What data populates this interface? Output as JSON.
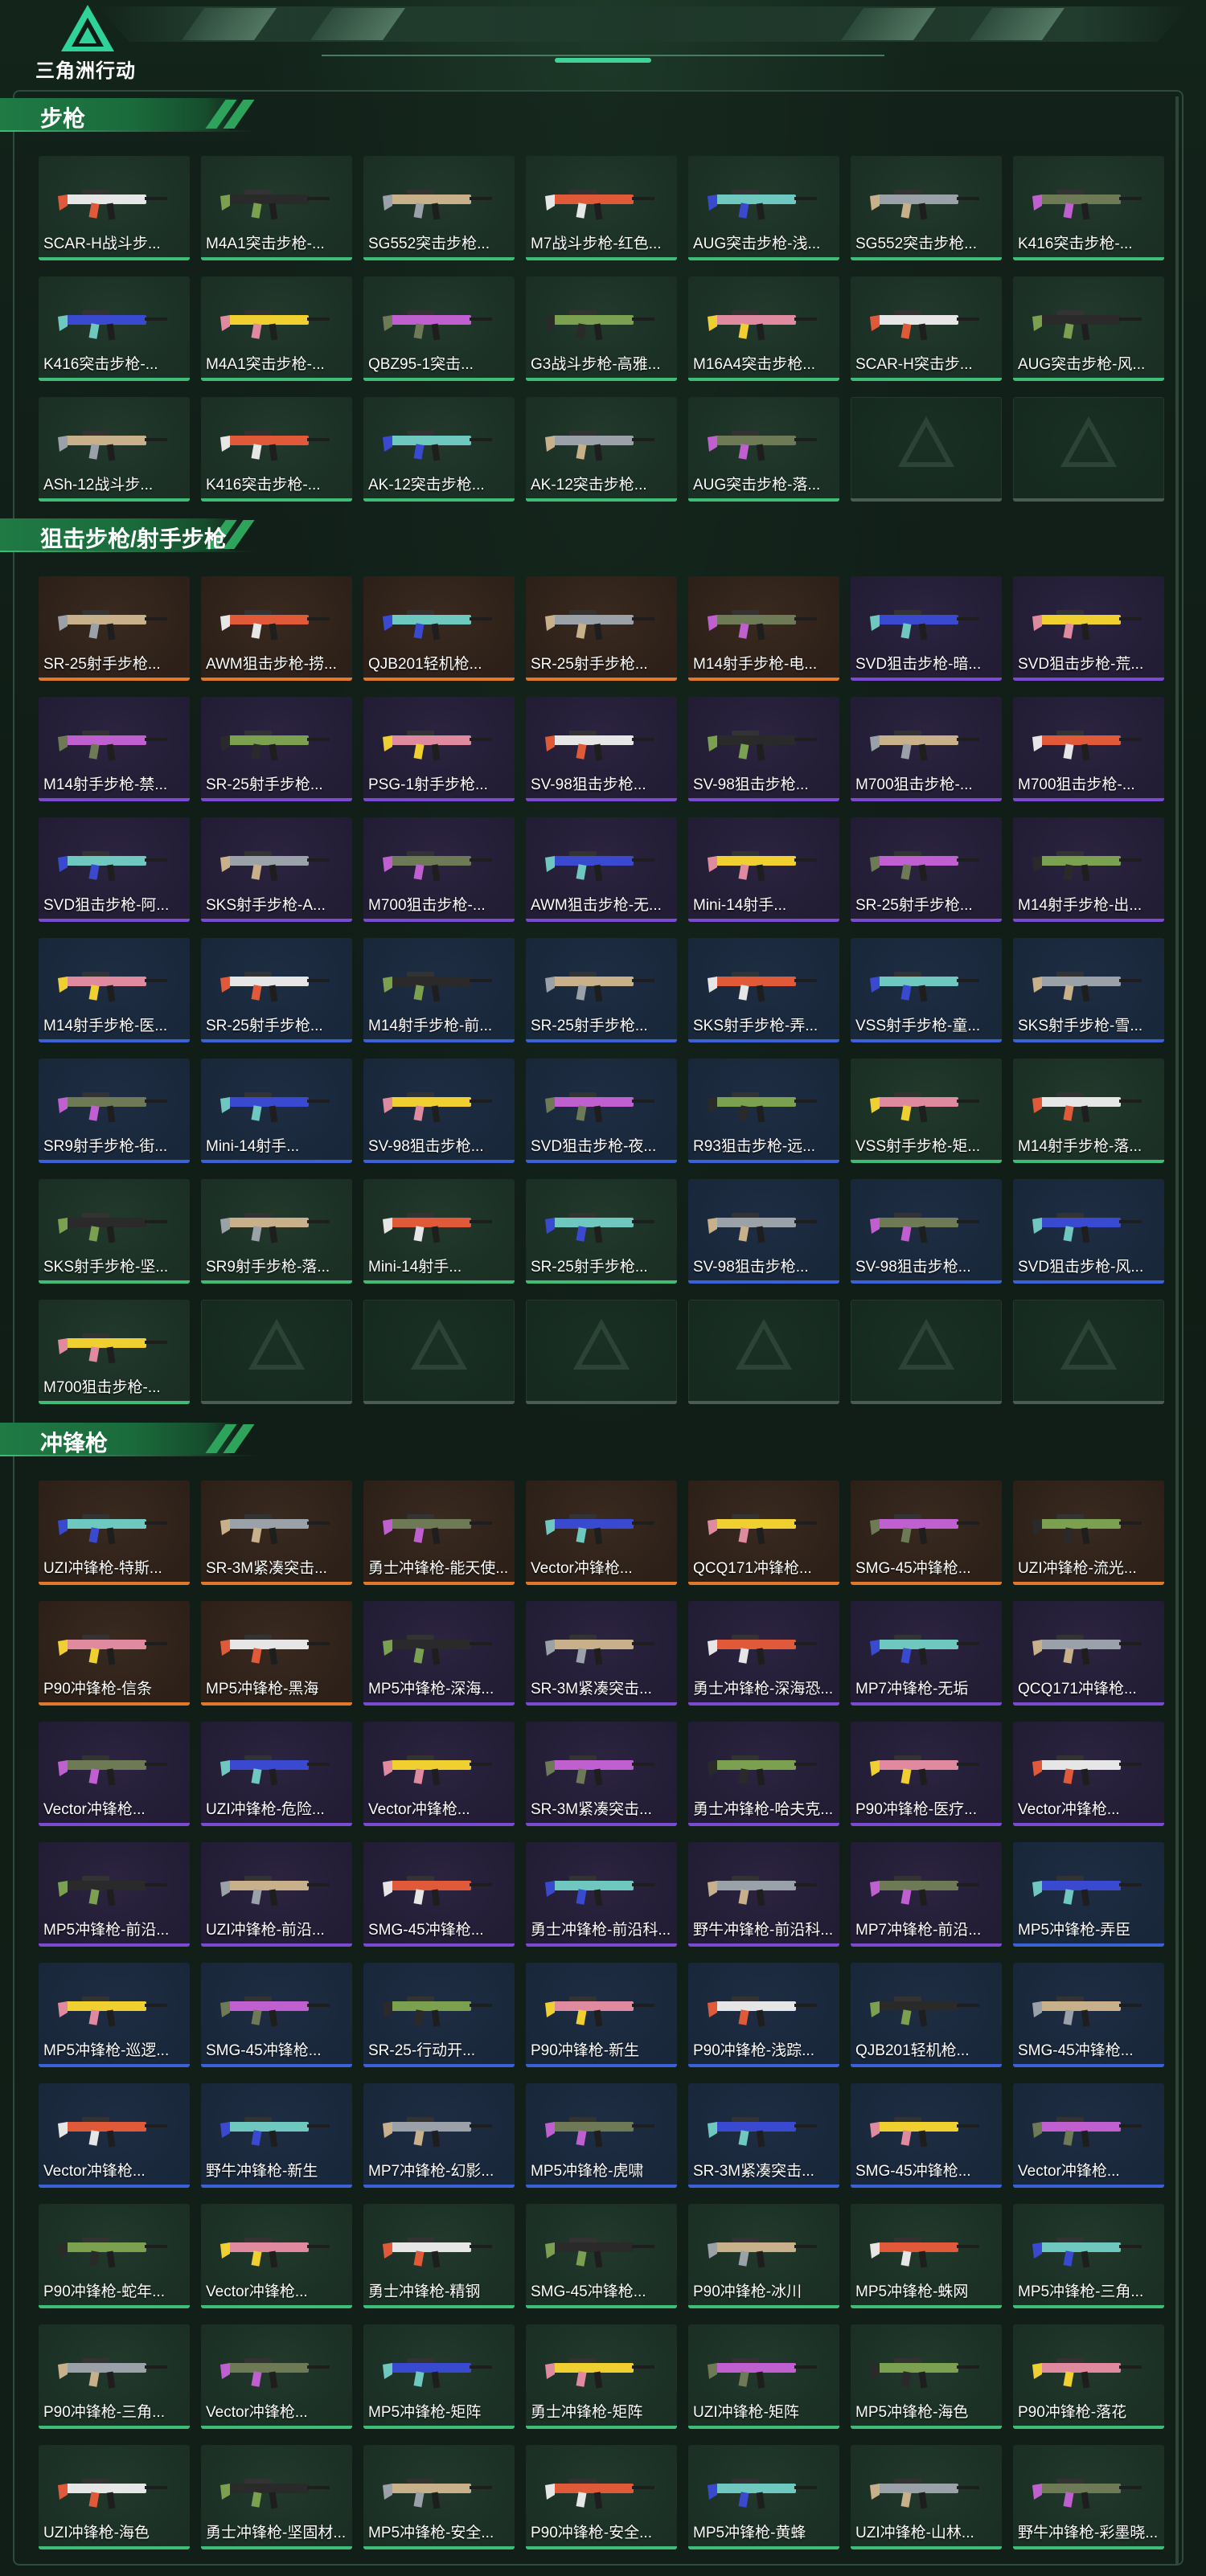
{
  "header": {
    "logo_text": "三角洲行动",
    "logo_icon": "delta-triangle-logo",
    "accent": "#3fd39a"
  },
  "colors": {
    "green": "#3fbd78",
    "blue": "#3a62d6",
    "purple": "#7a4bd0",
    "orange": "#e07a2a",
    "gray": "#4b5c52"
  },
  "sections": [
    {
      "title": "步枪",
      "items": [
        {
          "label": "SCAR-H战斗步...",
          "rarity": "green"
        },
        {
          "label": "M4A1突击步枪-...",
          "rarity": "green"
        },
        {
          "label": "SG552突击步枪...",
          "rarity": "green"
        },
        {
          "label": "M7战斗步枪-红色...",
          "rarity": "green"
        },
        {
          "label": "AUG突击步枪-浅...",
          "rarity": "green"
        },
        {
          "label": "SG552突击步枪...",
          "rarity": "green"
        },
        {
          "label": "K416突击步枪-...",
          "rarity": "green"
        },
        {
          "label": "K416突击步枪-...",
          "rarity": "green"
        },
        {
          "label": "M4A1突击步枪-...",
          "rarity": "green"
        },
        {
          "label": "QBZ95-1突击...",
          "rarity": "green"
        },
        {
          "label": "G3战斗步枪-高雅...",
          "rarity": "green"
        },
        {
          "label": "M16A4突击步枪...",
          "rarity": "green"
        },
        {
          "label": "SCAR-H突击步...",
          "rarity": "green"
        },
        {
          "label": "AUG突击步枪-风...",
          "rarity": "green"
        },
        {
          "label": "ASh-12战斗步...",
          "rarity": "green"
        },
        {
          "label": "K416突击步枪-...",
          "rarity": "green"
        },
        {
          "label": "AK-12突击步枪...",
          "rarity": "green"
        },
        {
          "label": "AK-12突击步枪...",
          "rarity": "green"
        },
        {
          "label": "AUG突击步枪-落...",
          "rarity": "green"
        },
        {
          "label": "",
          "rarity": "empty"
        },
        {
          "label": "",
          "rarity": "empty"
        }
      ]
    },
    {
      "title": "狙击步枪/射手步枪",
      "items": [
        {
          "label": "SR-25射手步枪...",
          "rarity": "orange"
        },
        {
          "label": "AWM狙击步枪-捞...",
          "rarity": "orange"
        },
        {
          "label": "QJB201轻机枪...",
          "rarity": "orange"
        },
        {
          "label": "SR-25射手步枪...",
          "rarity": "orange"
        },
        {
          "label": "M14射手步枪-电...",
          "rarity": "orange"
        },
        {
          "label": "SVD狙击步枪-暗...",
          "rarity": "purple"
        },
        {
          "label": "SVD狙击步枪-荒...",
          "rarity": "purple"
        },
        {
          "label": "M14射手步枪-禁...",
          "rarity": "purple"
        },
        {
          "label": "SR-25射手步枪...",
          "rarity": "purple"
        },
        {
          "label": "PSG-1射手步枪...",
          "rarity": "purple"
        },
        {
          "label": "SV-98狙击步枪...",
          "rarity": "purple"
        },
        {
          "label": "SV-98狙击步枪...",
          "rarity": "purple"
        },
        {
          "label": "M700狙击步枪-...",
          "rarity": "purple"
        },
        {
          "label": "M700狙击步枪-...",
          "rarity": "purple"
        },
        {
          "label": "SVD狙击步枪-阿...",
          "rarity": "purple"
        },
        {
          "label": "SKS射手步枪-A...",
          "rarity": "purple"
        },
        {
          "label": "M700狙击步枪-...",
          "rarity": "purple"
        },
        {
          "label": "AWM狙击步枪-无...",
          "rarity": "purple"
        },
        {
          "label": "Mini-14射手...",
          "rarity": "purple"
        },
        {
          "label": "SR-25射手步枪...",
          "rarity": "purple"
        },
        {
          "label": "M14射手步枪-出...",
          "rarity": "purple"
        },
        {
          "label": "M14射手步枪-医...",
          "rarity": "blue"
        },
        {
          "label": "SR-25射手步枪...",
          "rarity": "blue"
        },
        {
          "label": "M14射手步枪-前...",
          "rarity": "blue"
        },
        {
          "label": "SR-25射手步枪...",
          "rarity": "blue"
        },
        {
          "label": "SKS射手步枪-弄...",
          "rarity": "blue"
        },
        {
          "label": "VSS射手步枪-童...",
          "rarity": "blue"
        },
        {
          "label": "SKS射手步枪-雪...",
          "rarity": "blue"
        },
        {
          "label": "SR9射手步枪-街...",
          "rarity": "blue"
        },
        {
          "label": "Mini-14射手...",
          "rarity": "blue"
        },
        {
          "label": "SV-98狙击步枪...",
          "rarity": "blue"
        },
        {
          "label": "SVD狙击步枪-夜...",
          "rarity": "blue"
        },
        {
          "label": "R93狙击步枪-远...",
          "rarity": "blue"
        },
        {
          "label": "VSS射手步枪-矩...",
          "rarity": "green"
        },
        {
          "label": "M14射手步枪-落...",
          "rarity": "green"
        },
        {
          "label": "SKS射手步枪-坚...",
          "rarity": "green"
        },
        {
          "label": "SR9射手步枪-落...",
          "rarity": "green"
        },
        {
          "label": "Mini-14射手...",
          "rarity": "green"
        },
        {
          "label": "SR-25射手步枪...",
          "rarity": "green"
        },
        {
          "label": "SV-98狙击步枪...",
          "rarity": "blue"
        },
        {
          "label": "SV-98狙击步枪...",
          "rarity": "blue"
        },
        {
          "label": "SVD狙击步枪-风...",
          "rarity": "blue"
        },
        {
          "label": "M700狙击步枪-...",
          "rarity": "green"
        },
        {
          "label": "",
          "rarity": "empty"
        },
        {
          "label": "",
          "rarity": "empty"
        },
        {
          "label": "",
          "rarity": "empty"
        },
        {
          "label": "",
          "rarity": "empty"
        },
        {
          "label": "",
          "rarity": "empty"
        },
        {
          "label": "",
          "rarity": "empty"
        }
      ]
    },
    {
      "title": "冲锋枪",
      "items": [
        {
          "label": "UZI冲锋枪-特斯...",
          "rarity": "orange"
        },
        {
          "label": "SR-3M紧凑突击...",
          "rarity": "orange"
        },
        {
          "label": "勇士冲锋枪-能天使...",
          "rarity": "orange"
        },
        {
          "label": "Vector冲锋枪...",
          "rarity": "orange"
        },
        {
          "label": "QCQ171冲锋枪...",
          "rarity": "orange"
        },
        {
          "label": "SMG-45冲锋枪...",
          "rarity": "orange"
        },
        {
          "label": "UZI冲锋枪-流光...",
          "rarity": "orange"
        },
        {
          "label": "P90冲锋枪-信条",
          "rarity": "orange"
        },
        {
          "label": "MP5冲锋枪-黑海",
          "rarity": "orange"
        },
        {
          "label": "MP5冲锋枪-深海...",
          "rarity": "purple"
        },
        {
          "label": "SR-3M紧凑突击...",
          "rarity": "purple"
        },
        {
          "label": "勇士冲锋枪-深海恐...",
          "rarity": "purple"
        },
        {
          "label": "MP7冲锋枪-无垢",
          "rarity": "purple"
        },
        {
          "label": "QCQ171冲锋枪...",
          "rarity": "purple"
        },
        {
          "label": "Vector冲锋枪...",
          "rarity": "purple"
        },
        {
          "label": "UZI冲锋枪-危险...",
          "rarity": "purple"
        },
        {
          "label": "Vector冲锋枪...",
          "rarity": "purple"
        },
        {
          "label": "SR-3M紧凑突击...",
          "rarity": "purple"
        },
        {
          "label": "勇士冲锋枪-哈夫克...",
          "rarity": "purple"
        },
        {
          "label": "P90冲锋枪-医疗...",
          "rarity": "purple"
        },
        {
          "label": "Vector冲锋枪...",
          "rarity": "purple"
        },
        {
          "label": "MP5冲锋枪-前沿...",
          "rarity": "purple"
        },
        {
          "label": "UZI冲锋枪-前沿...",
          "rarity": "purple"
        },
        {
          "label": "SMG-45冲锋枪...",
          "rarity": "purple"
        },
        {
          "label": "勇士冲锋枪-前沿科...",
          "rarity": "purple"
        },
        {
          "label": "野牛冲锋枪-前沿科...",
          "rarity": "purple"
        },
        {
          "label": "MP7冲锋枪-前沿...",
          "rarity": "purple"
        },
        {
          "label": "MP5冲锋枪-弄臣",
          "rarity": "blue"
        },
        {
          "label": "MP5冲锋枪-巡逻...",
          "rarity": "blue"
        },
        {
          "label": "SMG-45冲锋枪...",
          "rarity": "blue"
        },
        {
          "label": "SR-25-行动开...",
          "rarity": "blue"
        },
        {
          "label": "P90冲锋枪-新生",
          "rarity": "blue"
        },
        {
          "label": "P90冲锋枪-浅踪...",
          "rarity": "blue"
        },
        {
          "label": "QJB201轻机枪...",
          "rarity": "blue"
        },
        {
          "label": "SMG-45冲锋枪...",
          "rarity": "blue"
        },
        {
          "label": "Vector冲锋枪...",
          "rarity": "blue"
        },
        {
          "label": "野牛冲锋枪-新生",
          "rarity": "blue"
        },
        {
          "label": "MP7冲锋枪-幻影...",
          "rarity": "blue"
        },
        {
          "label": "MP5冲锋枪-虎啸",
          "rarity": "blue"
        },
        {
          "label": "SR-3M紧凑突击...",
          "rarity": "blue"
        },
        {
          "label": "SMG-45冲锋枪...",
          "rarity": "blue"
        },
        {
          "label": "Vector冲锋枪...",
          "rarity": "blue"
        },
        {
          "label": "P90冲锋枪-蛇年...",
          "rarity": "green"
        },
        {
          "label": "Vector冲锋枪...",
          "rarity": "green"
        },
        {
          "label": "勇士冲锋枪-精钢",
          "rarity": "green"
        },
        {
          "label": "SMG-45冲锋枪...",
          "rarity": "green"
        },
        {
          "label": "P90冲锋枪-冰川",
          "rarity": "green"
        },
        {
          "label": "MP5冲锋枪-蛛网",
          "rarity": "green"
        },
        {
          "label": "MP5冲锋枪-三角...",
          "rarity": "green"
        },
        {
          "label": "P90冲锋枪-三角...",
          "rarity": "green"
        },
        {
          "label": "Vector冲锋枪...",
          "rarity": "green"
        },
        {
          "label": "MP5冲锋枪-矩阵",
          "rarity": "green"
        },
        {
          "label": "勇士冲锋枪-矩阵",
          "rarity": "green"
        },
        {
          "label": "UZI冲锋枪-矩阵",
          "rarity": "green"
        },
        {
          "label": "MP5冲锋枪-海色",
          "rarity": "green"
        },
        {
          "label": "P90冲锋枪-落花",
          "rarity": "green"
        },
        {
          "label": "UZI冲锋枪-海色",
          "rarity": "green"
        },
        {
          "label": "勇士冲锋枪-坚固材...",
          "rarity": "green"
        },
        {
          "label": "MP5冲锋枪-安全...",
          "rarity": "green"
        },
        {
          "label": "P90冲锋枪-安全...",
          "rarity": "green"
        },
        {
          "label": "MP5冲锋枪-黄蜂",
          "rarity": "green"
        },
        {
          "label": "UZI冲锋枪-山林...",
          "rarity": "green"
        },
        {
          "label": "野牛冲锋枪-彩墨晓...",
          "rarity": "green"
        }
      ]
    }
  ]
}
